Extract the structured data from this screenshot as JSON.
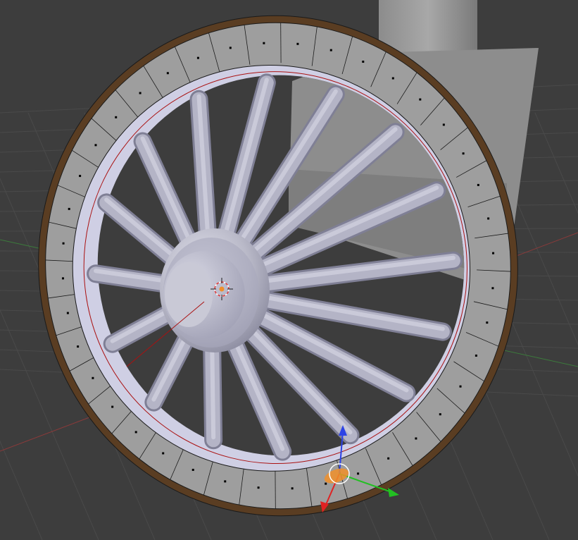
{
  "viewport": {
    "background": "#3d3d3d",
    "grid_color": "#4a4a4a",
    "axis_x_color": "#8a3a3a",
    "axis_y_color": "#3c7a3c"
  },
  "objects": [
    {
      "name": "wagon-wheel",
      "selected": true
    },
    {
      "name": "wagon-body-panel",
      "selected": false
    },
    {
      "name": "cylinder-stack",
      "selected": false
    }
  ],
  "wheel": {
    "spoke_count": 16,
    "rim_segment_count": 40,
    "tire_color": "#5a3d22",
    "rim_color": "#9e9e9e",
    "spoke_color": "#b4b4c6",
    "hub_color": "#c4c4d4",
    "edge_color": "#1a1a1a",
    "active_edge_color": "#aa1111"
  },
  "gizmo": {
    "axis_z_color": "#2d43e6",
    "axis_x_color": "#e02222",
    "axis_y_color": "#22c022",
    "center_color": "#ffffff",
    "pivot_color": "#f08f2a"
  },
  "cursor_3d": {
    "ring_color": "#e03a3a",
    "center_color": "#f08f2a"
  }
}
